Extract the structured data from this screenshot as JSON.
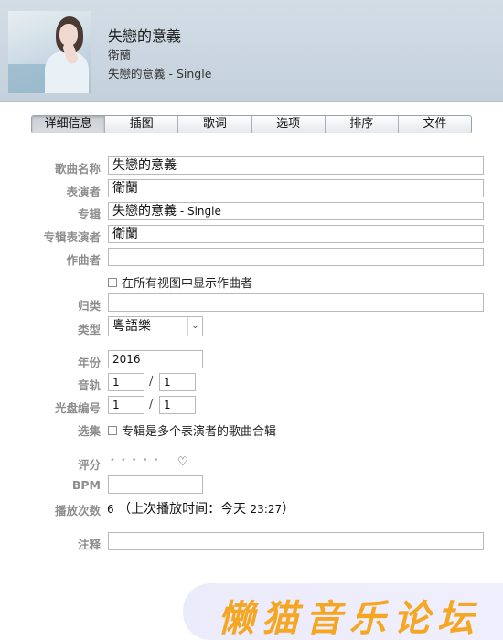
{
  "header": {
    "title": "失戀的意義",
    "artist": "衛蘭",
    "album": "失戀的意義 - Single"
  },
  "tabs": [
    {
      "label": "详细信息",
      "active": true
    },
    {
      "label": "插图"
    },
    {
      "label": "歌词"
    },
    {
      "label": "选项"
    },
    {
      "label": "排序"
    },
    {
      "label": "文件"
    }
  ],
  "form": {
    "song_name": {
      "label": "歌曲名称",
      "value": "失戀的意義"
    },
    "artist": {
      "label": "表演者",
      "value": "衛蘭"
    },
    "album": {
      "label": "专辑",
      "value_main": "失戀的意義",
      "value_suffix": " - Single"
    },
    "album_artist": {
      "label": "专辑表演者",
      "value": "衛蘭"
    },
    "composer": {
      "label": "作曲者",
      "value": ""
    },
    "show_composer": {
      "label": "在所有视图中显示作曲者",
      "checked": false
    },
    "grouping": {
      "label": "归类",
      "value": ""
    },
    "genre": {
      "label": "类型",
      "value": "粵語樂"
    },
    "year": {
      "label": "年份",
      "value": "2016"
    },
    "track": {
      "label": "音轨",
      "number": "1",
      "total": "1"
    },
    "disc": {
      "label": "光盘编号",
      "number": "1",
      "total": "1"
    },
    "compilation": {
      "label": "选集",
      "checkbox_label": "专辑是多个表演者的歌曲合辑",
      "checked": false
    },
    "rating": {
      "label": "评分",
      "stars": 0
    },
    "bpm": {
      "label": "BPM",
      "value": ""
    },
    "play_count": {
      "label": "播放次数",
      "count": "6",
      "last_played_prefix": "（上次播放时间：今天 ",
      "last_played_time": "23:27",
      "last_played_suffix": "）"
    },
    "comments": {
      "label": "注释",
      "value": ""
    }
  },
  "watermark": {
    "text": "懒猫音乐论坛"
  }
}
